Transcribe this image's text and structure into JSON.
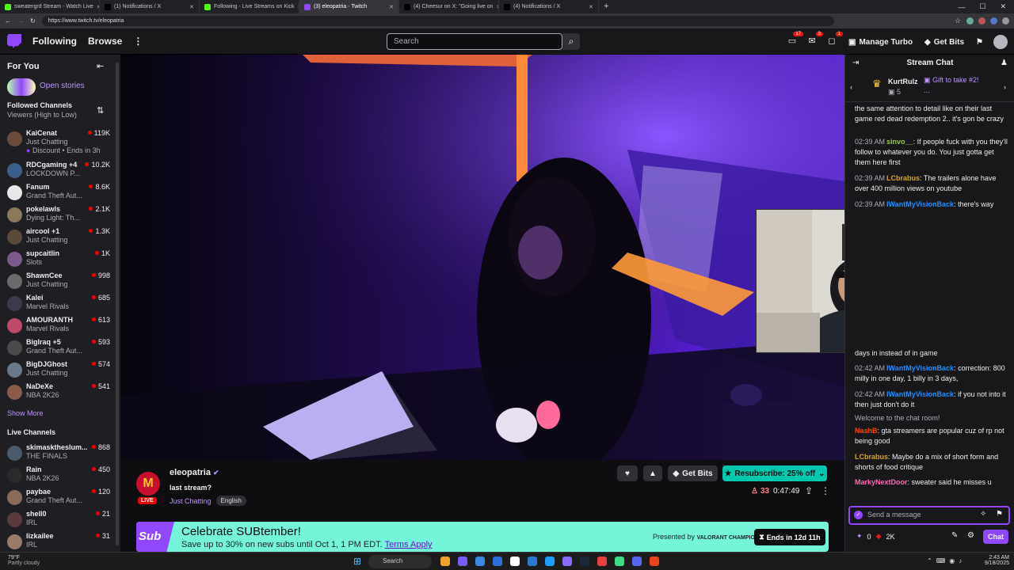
{
  "browser": {
    "tabs": [
      {
        "title": "sweatergrd Stream - Watch Live",
        "fav": "twitch-k",
        "color": "#53fc18"
      },
      {
        "title": "(1) Notifications / X",
        "fav": "x",
        "color": "#000000"
      },
      {
        "title": "Following - Live Streams on Kick",
        "fav": "kick",
        "color": "#53fc18"
      },
      {
        "title": "(3) eleopatria - Twitch",
        "fav": "twitch",
        "color": "#9147ff",
        "active": true
      },
      {
        "title": "(4) Cheesur on X: \"Going live on",
        "fav": "x",
        "color": "#000000"
      },
      {
        "title": "(4) Notifications / X",
        "fav": "x",
        "color": "#000000"
      }
    ],
    "url": "https://www.twitch.tv/eleopatria",
    "newtab": "+",
    "win_min": "—",
    "win_max": "☐",
    "win_close": "✕"
  },
  "nav": {
    "following": "Following",
    "browse": "Browse",
    "more": "⋮",
    "search_placeholder": "Search",
    "badges": {
      "inbox": "17",
      "whispers": "3",
      "alerts": "1"
    },
    "turbo": "Manage Turbo",
    "bits": "Get Bits"
  },
  "sidebar": {
    "for_you": "For You",
    "open_stories": "Open stories",
    "followed": "Followed Channels",
    "sort": "Viewers (High to Low)",
    "channels": [
      {
        "name": "KaiCenat",
        "game": "Just Chatting",
        "viewers": "119K",
        "extra": "Discount • Ends in 3h",
        "color": "#6b4c3b"
      },
      {
        "name": "RDCgaming +4",
        "game": "LOCKDOWN P...",
        "viewers": "10.2K",
        "color": "#3a5f8a"
      },
      {
        "name": "Fanum",
        "game": "Grand Theft Aut...",
        "viewers": "8.6K",
        "color": "#e8e8e8"
      },
      {
        "name": "pokelawls",
        "game": "Dying Light: Th...",
        "viewers": "2.1K",
        "color": "#8a7a5a"
      },
      {
        "name": "aircool +1",
        "game": "Just Chatting",
        "viewers": "1.3K",
        "color": "#5a4a3a"
      },
      {
        "name": "supcaitlin",
        "game": "Slots",
        "viewers": "1K",
        "color": "#7a5a8a"
      },
      {
        "name": "ShawnCee",
        "game": "Just Chatting",
        "viewers": "998",
        "color": "#6a6a6a"
      },
      {
        "name": "Kalei",
        "game": "Marvel Rivals",
        "viewers": "685",
        "color": "#3a3a4a"
      },
      {
        "name": "AMOURANTH",
        "game": "Marvel Rivals",
        "viewers": "613",
        "color": "#c04a6a"
      },
      {
        "name": "BigIraq +5",
        "game": "Grand Theft Aut...",
        "viewers": "593",
        "color": "#4a4a4a"
      },
      {
        "name": "BigDJGhost",
        "game": "Just Chatting",
        "viewers": "574",
        "color": "#6a7a8a"
      },
      {
        "name": "NaDeXe",
        "game": "NBA 2K26",
        "viewers": "541",
        "color": "#8a5a4a"
      }
    ],
    "show_more": "Show More",
    "live": "Live Channels",
    "live_channels": [
      {
        "name": "skimasktheslum...",
        "game": "THE FINALS",
        "viewers": "868",
        "color": "#4a5a6a"
      },
      {
        "name": "Rain",
        "game": "NBA 2K26",
        "viewers": "450",
        "color": "#2a2a2a"
      },
      {
        "name": "paybae",
        "game": "Grand Theft Aut...",
        "viewers": "120",
        "color": "#8a6a5a"
      },
      {
        "name": "shell0",
        "game": "IRL",
        "viewers": "21",
        "color": "#5a3a3a"
      },
      {
        "name": "lizkailee",
        "game": "IRL",
        "viewers": "31",
        "color": "#9a7a6a"
      }
    ]
  },
  "stream": {
    "live": "LIVE",
    "streamer": "eleopatria",
    "title": "last stream?",
    "category": "Just Chatting",
    "tag": "English",
    "get_bits": "Get Bits",
    "resub": "Resubscribe: 25% off",
    "viewers": "33",
    "uptime": "0:47:49",
    "more": "⋮"
  },
  "banner": {
    "title": "Celebrate SUBtember!",
    "sub": "Save up to 30% on new subs until Oct 1, 1 PM EDT.",
    "terms": "Terms Apply",
    "presented": "Presented by",
    "sponsor": "VALORANT CHAMPIONS",
    "ends": "Ends in 12d 11h",
    "logo": "Sub"
  },
  "chat": {
    "title": "Stream Chat",
    "gift_user": "KurtRulz",
    "gift_count": "5",
    "gift_text": "Gift to take #2!",
    "gift_more": "...",
    "messages_top": [
      {
        "t": "",
        "u": "",
        "c": "#efeff1",
        "m": "the same attention to detail like on their last game red dead redemption 2.. it's gon be crazy"
      },
      {
        "t": "02:39 AM",
        "u": "sinvo__",
        "c": "#9acd32",
        "m": "If people fuck with you they'll follow to whatever you do. You just gotta get them here first"
      },
      {
        "t": "02:39 AM",
        "u": "LCbrabus",
        "c": "#daa520",
        "m": "The trailers alone have over 400 million views on youtube"
      },
      {
        "t": "02:39 AM",
        "u": "IWantMyVisionBack",
        "c": "#1e90ff",
        "m": "there's way"
      }
    ],
    "messages_bottom": [
      {
        "t": "",
        "u": "",
        "c": "#efeff1",
        "m": "days in instead of in game"
      },
      {
        "t": "02:42 AM",
        "u": "IWantMyVisionBack",
        "c": "#1e90ff",
        "m": "correction: 800 milly in one day, 1 billy in 3 days,"
      },
      {
        "t": "02:42 AM",
        "u": "IWantMyVisionBack",
        "c": "#1e90ff",
        "m": "if you not into it then just don't do it"
      },
      {
        "t": "",
        "u": "",
        "c": "#adadb8",
        "m": "Welcome to the chat room!"
      },
      {
        "t": "",
        "u": "NashB",
        "c": "#ff4500",
        "m": "gta streamers are popular cuz of rp not being good"
      },
      {
        "t": "",
        "u": "LCbrabus",
        "c": "#daa520",
        "m": "Maybe do a mix of short form and shorts of food critique"
      },
      {
        "t": "",
        "u": "MarkyNextDoor",
        "c": "#ff69b4",
        "m": "sweater said he misses u"
      }
    ],
    "input_placeholder": "Send a message",
    "points": "0",
    "bits_count": "2K",
    "chat_btn": "Chat"
  },
  "taskbar": {
    "weather": "79°F",
    "weather_desc": "Partly cloudy",
    "search": "Search",
    "time": "2:43 AM",
    "date": "9/18/2025"
  },
  "colors": {
    "twitch_purple": "#9147ff",
    "live_red": "#eb0400",
    "resub_green": "#00c8af",
    "banner": "#74f4d9"
  }
}
